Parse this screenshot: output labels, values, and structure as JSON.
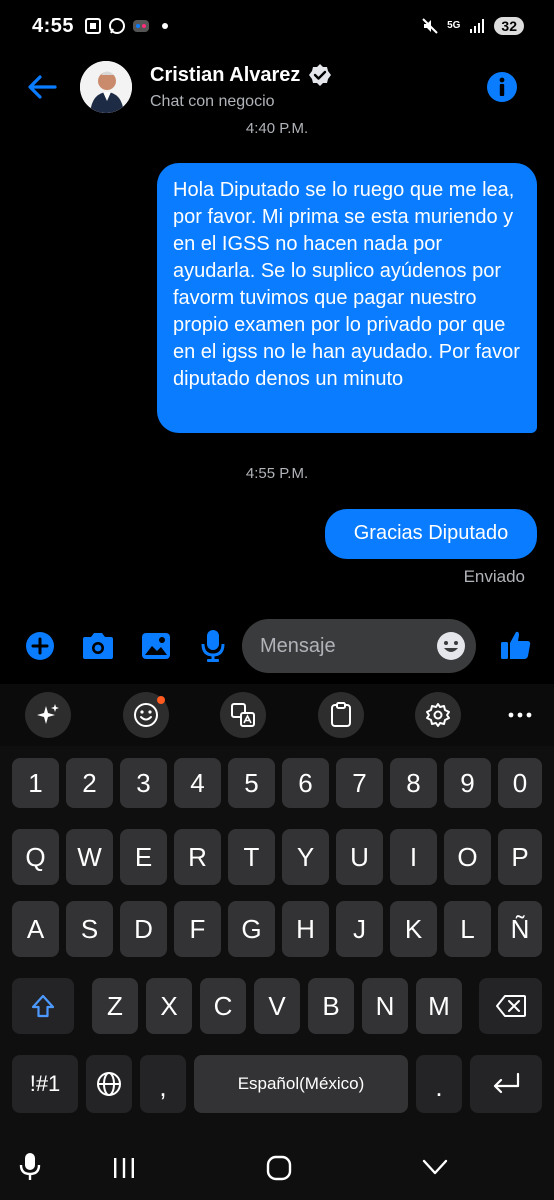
{
  "status_bar": {
    "time": "4:55",
    "battery": "32",
    "network": "5G"
  },
  "header": {
    "contact_name": "Cristian Alvarez",
    "subtitle": "Chat con negocio",
    "accent_color": "#0a7cff"
  },
  "messages": {
    "timestamp_1": "4:40 P.M.",
    "message_1": "Hola Diputado se lo ruego que me lea, por favor. Mi prima se esta muriendo y en el IGSS no hacen nada por ayudarla. Se lo suplico ayúdenos por favorm tuvimos que pagar nuestro propio examen por lo privado por que en el igss no le han ayudado. Por favor diputado denos un minuto",
    "timestamp_2": "4:55 P.M.",
    "message_2": "Gracias Diputado",
    "status": "Enviado"
  },
  "composer": {
    "placeholder": "Mensaje",
    "icons": [
      "plus-circle-icon",
      "camera-icon",
      "image-icon",
      "microphone-icon",
      "emoji-icon",
      "thumbs-up-icon"
    ]
  },
  "keyboard": {
    "toolbar_icons": [
      "sparkle-icon",
      "emoji-icon",
      "translate-icon",
      "clipboard-icon",
      "settings-icon",
      "more-icon"
    ],
    "row_numbers": [
      "1",
      "2",
      "3",
      "4",
      "5",
      "6",
      "7",
      "8",
      "9",
      "0"
    ],
    "row_1": [
      "Q",
      "W",
      "E",
      "R",
      "T",
      "Y",
      "U",
      "I",
      "O",
      "P"
    ],
    "row_2": [
      "A",
      "S",
      "D",
      "F",
      "G",
      "H",
      "J",
      "K",
      "L",
      "Ñ"
    ],
    "row_3": [
      "Z",
      "X",
      "C",
      "V",
      "B",
      "N",
      "M"
    ],
    "symbols_key": "!#1",
    "comma_key": ",",
    "space_label": "Español(México)",
    "period_key": "."
  },
  "navigation": {
    "icons": [
      "mic-icon",
      "recent-apps-icon",
      "home-icon",
      "back-chevron-icon"
    ]
  }
}
